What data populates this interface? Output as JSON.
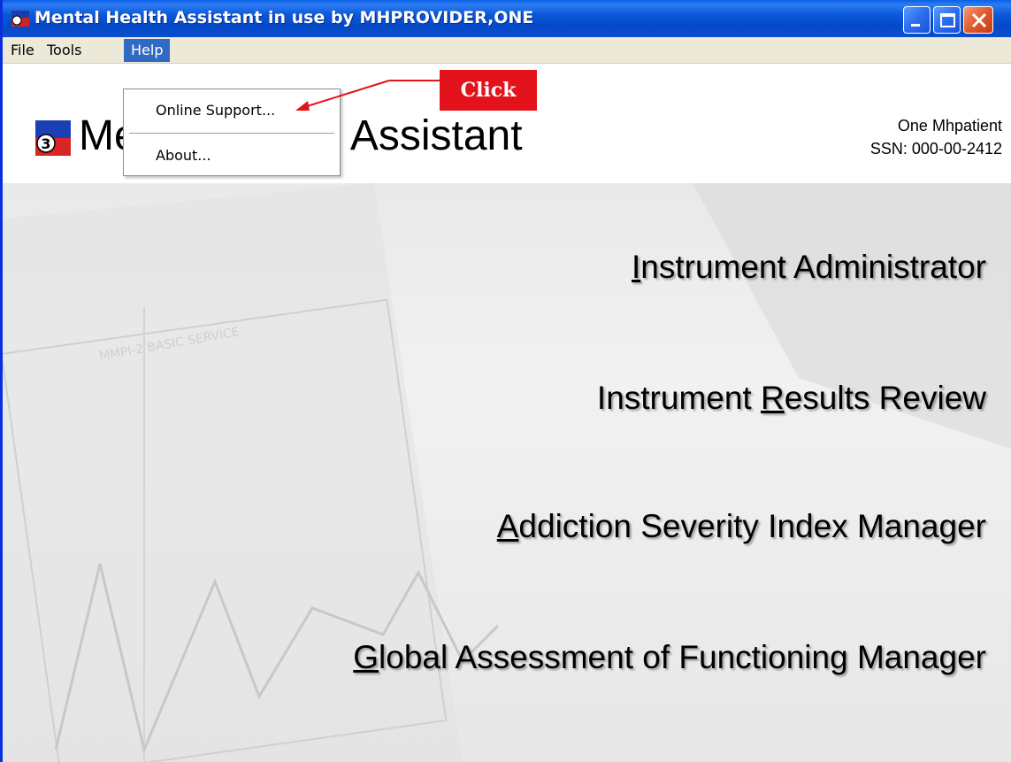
{
  "window": {
    "title": "Mental Health Assistant in use by MHPROVIDER,ONE",
    "icon": "mha-app-icon"
  },
  "menubar": {
    "items": [
      {
        "label": "File"
      },
      {
        "label": "Tools"
      },
      {
        "label": "Help"
      }
    ]
  },
  "help_menu": {
    "items": [
      {
        "label": "Online Support..."
      },
      {
        "label": "About..."
      }
    ]
  },
  "header": {
    "app_title": "Mental Health Assistant",
    "patient_name": "One Mhpatient",
    "patient_ssn": "SSN: 000-00-2412"
  },
  "nav": {
    "items": [
      {
        "pre": "",
        "mnemonic": "I",
        "post": "nstrument Administrator"
      },
      {
        "pre": "Instrument ",
        "mnemonic": "R",
        "post": "esults Review"
      },
      {
        "pre": "",
        "mnemonic": "A",
        "post": "ddiction Severity Index Manager"
      },
      {
        "pre": "",
        "mnemonic": "G",
        "post": "lobal Assessment of Functioning Manager"
      }
    ]
  },
  "annotation": {
    "label": "Click",
    "color": "#e3121b"
  },
  "colors": {
    "titlebar": "#0a58d8",
    "menu_highlight": "#316ac5",
    "menubar": "#ece9d8"
  }
}
